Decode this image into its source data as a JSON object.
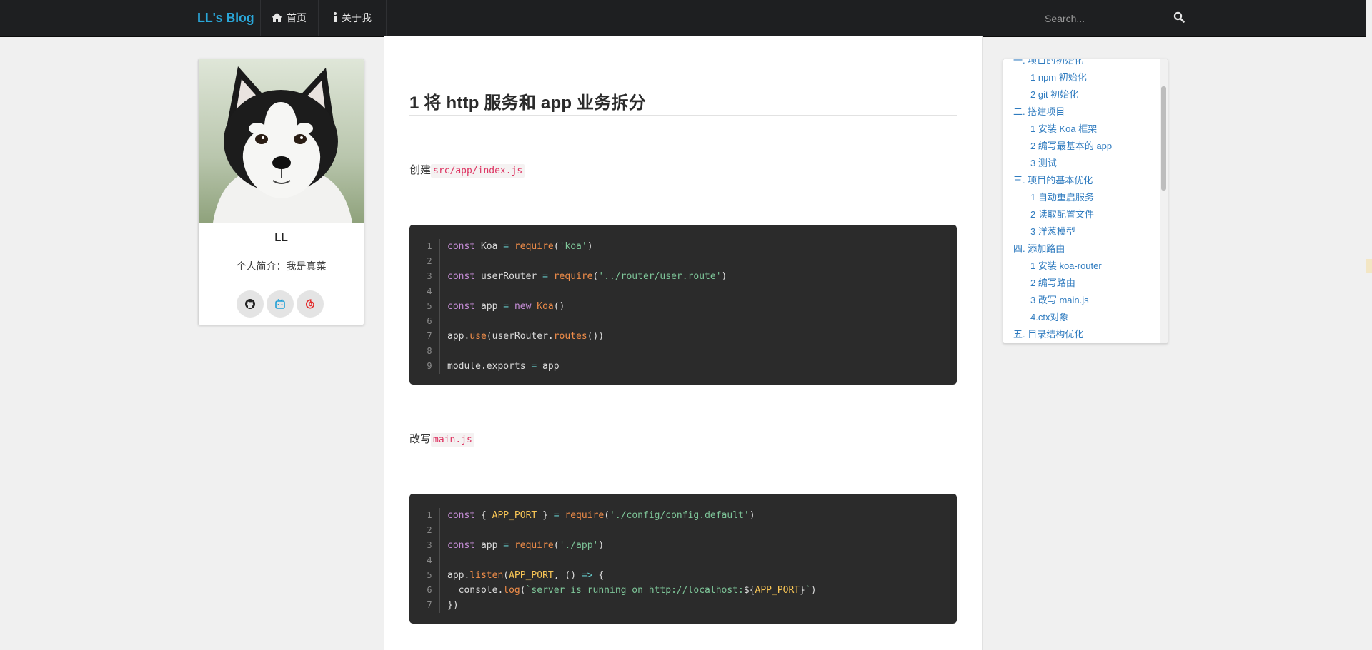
{
  "navbar": {
    "brand": "LL's Blog",
    "home_label": "首页",
    "about_label": "关于我",
    "search_placeholder": "Search..."
  },
  "profile": {
    "name": "LL",
    "bio": "个人简介：我是真菜",
    "social": [
      "github-icon",
      "bilibili-icon",
      "netease-music-icon"
    ]
  },
  "article": {
    "heading": "1 将 http 服务和 app 业务拆分",
    "para1_prefix": "创建",
    "para1_code": "src/app/index.js",
    "para2_prefix": "改写",
    "para2_code": "main.js",
    "code1_line_numbers": [
      "1",
      "2",
      "3",
      "4",
      "5",
      "6",
      "7",
      "8",
      "9"
    ],
    "code2_line_numbers": [
      "1",
      "2",
      "3",
      "4",
      "5",
      "6",
      "7"
    ],
    "code1_text": [
      "const Koa = require('koa')",
      "",
      "const userRouter = require('../router/user.route')",
      "",
      "const app = new Koa()",
      "",
      "app.use(userRouter.routes())",
      "",
      "module.exports = app"
    ],
    "code2_text": [
      "const { APP_PORT } = require('./config/config.default')",
      "",
      "const app = require('./app')",
      "",
      "app.listen(APP_PORT, () => {",
      "  console.log(`server is running on http://localhost:${APP_PORT}`)",
      "})"
    ]
  },
  "toc": {
    "items": [
      {
        "label": "一. 项目的初始化",
        "level": 1
      },
      {
        "label": "1 npm 初始化",
        "level": 2
      },
      {
        "label": "2 git 初始化",
        "level": 2
      },
      {
        "label": "二. 搭建项目",
        "level": 1
      },
      {
        "label": "1 安装 Koa 框架",
        "level": 2
      },
      {
        "label": "2 编写最基本的 app",
        "level": 2
      },
      {
        "label": "3 测试",
        "level": 2
      },
      {
        "label": "三. 项目的基本优化",
        "level": 1
      },
      {
        "label": "1 自动重启服务",
        "level": 2
      },
      {
        "label": "2 读取配置文件",
        "level": 2
      },
      {
        "label": "3 洋葱模型",
        "level": 2
      },
      {
        "label": "四. 添加路由",
        "level": 1
      },
      {
        "label": "1 安装 koa-router",
        "level": 2
      },
      {
        "label": "2 编写路由",
        "level": 2
      },
      {
        "label": "3 改写 main.js",
        "level": 2
      },
      {
        "label": "4.ctx对象",
        "level": 2
      },
      {
        "label": "五. 目录结构优化",
        "level": 1
      }
    ]
  },
  "colors": {
    "navbar_bg": "#1e1f21",
    "brand": "#2aa7d9",
    "link": "#2f7bbf",
    "code_bg": "#2b2b2b",
    "inline_code": "#dd3462"
  }
}
